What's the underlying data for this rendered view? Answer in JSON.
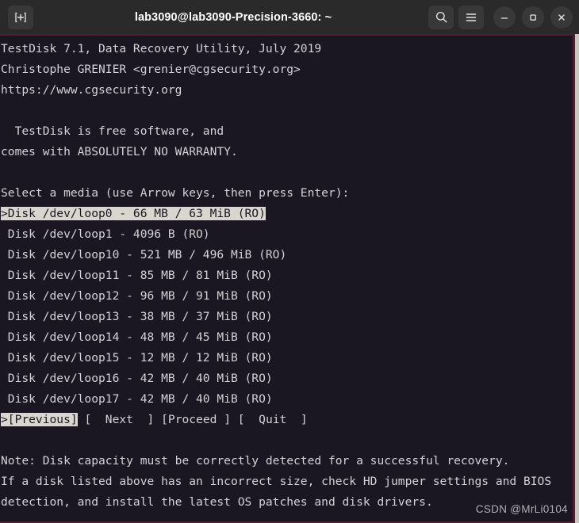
{
  "window": {
    "title": "lab3090@lab3090-Precision-3660: ~",
    "new_tab_icon": "new-tab-icon",
    "search_icon": "search-icon",
    "menu_icon": "hamburger-menu-icon",
    "minimize_icon": "minimize-icon",
    "maximize_icon": "maximize-icon",
    "close_icon": "close-icon",
    "titlebar_color": "#2b2a2a",
    "terminal_bg": "#1a1722",
    "terminal_fg": "#d4d2d6",
    "border_color": "#4a1f2e",
    "highlight_bg": "#d9d6d0",
    "highlight_fg": "#1a1722"
  },
  "terminal": {
    "lines": [
      {
        "text": "TestDisk 7.1, Data Recovery Utility, July 2019",
        "highlight": false
      },
      {
        "text": "Christophe GRENIER <grenier@cgsecurity.org>",
        "highlight": false
      },
      {
        "text": "https://www.cgsecurity.org",
        "highlight": false
      },
      {
        "text": "",
        "highlight": false
      },
      {
        "text": "  TestDisk is free software, and",
        "highlight": false
      },
      {
        "text": "comes with ABSOLUTELY NO WARRANTY.",
        "highlight": false
      },
      {
        "text": "",
        "highlight": false
      },
      {
        "text": "Select a media (use Arrow keys, then press Enter):",
        "highlight": false
      },
      {
        "text": ">Disk /dev/loop0 - 66 MB / 63 MiB (RO)",
        "highlight": true
      },
      {
        "text": " Disk /dev/loop1 - 4096 B (RO)",
        "highlight": false
      },
      {
        "text": " Disk /dev/loop10 - 521 MB / 496 MiB (RO)",
        "highlight": false
      },
      {
        "text": " Disk /dev/loop11 - 85 MB / 81 MiB (RO)",
        "highlight": false
      },
      {
        "text": " Disk /dev/loop12 - 96 MB / 91 MiB (RO)",
        "highlight": false
      },
      {
        "text": " Disk /dev/loop13 - 38 MB / 37 MiB (RO)",
        "highlight": false
      },
      {
        "text": " Disk /dev/loop14 - 48 MB / 45 MiB (RO)",
        "highlight": false
      },
      {
        "text": " Disk /dev/loop15 - 12 MB / 12 MiB (RO)",
        "highlight": false
      },
      {
        "text": " Disk /dev/loop16 - 42 MB / 40 MiB (RO)",
        "highlight": false
      },
      {
        "text": " Disk /dev/loop17 - 42 MB / 40 MiB (RO)",
        "highlight": false
      }
    ],
    "action_row": {
      "previous": ">[Previous]",
      "next": "[  Next  ]",
      "proceed": "[Proceed ]",
      "quit": "[  Quit  ]",
      "selected": "previous"
    },
    "notes": [
      "Note: Disk capacity must be correctly detected for a successful recovery.",
      "If a disk listed above has an incorrect size, check HD jumper settings and BIOS",
      "detection, and install the latest OS patches and disk drivers."
    ]
  },
  "watermark": {
    "text": "CSDN @MrLi0104"
  }
}
